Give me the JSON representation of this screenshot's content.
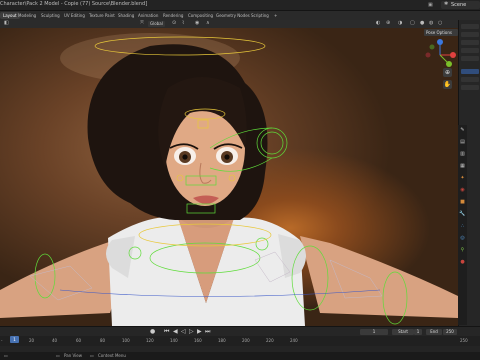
{
  "window": {
    "title": "Character\\Pack 2 Model - Copie (77) Source\\Blender.blend]"
  },
  "scene": {
    "label": "Scene"
  },
  "workspace_tabs": [
    "Layout",
    "Modeling",
    "Sculpting",
    "UV Editing",
    "Texture Paint",
    "Shading",
    "Animation",
    "Rendering",
    "Compositing",
    "Geometry Nodes",
    "Scripting"
  ],
  "header": {
    "orientation": "Global",
    "pose_options": "Pose Options"
  },
  "timeline": {
    "current_frame": "1",
    "start_label": "Start",
    "start_value": "1",
    "end_label": "End",
    "end_value": "250"
  },
  "ruler_ticks": [
    "0",
    "20",
    "40",
    "60",
    "80",
    "100",
    "120",
    "140",
    "160",
    "180",
    "200",
    "220",
    "240",
    "250"
  ],
  "ruler_first": "-",
  "playhead_frame": "1",
  "status": {
    "pan_view": "Pan View",
    "context_menu": "Context Menu"
  },
  "colors": {
    "accent": "#4772b3",
    "rig_green": "#5fdc3a",
    "rig_yellow": "#e8c83a",
    "gizmo_x": "#e0413f",
    "gizmo_y": "#7bbf2a",
    "gizmo_z": "#3a78e0"
  }
}
